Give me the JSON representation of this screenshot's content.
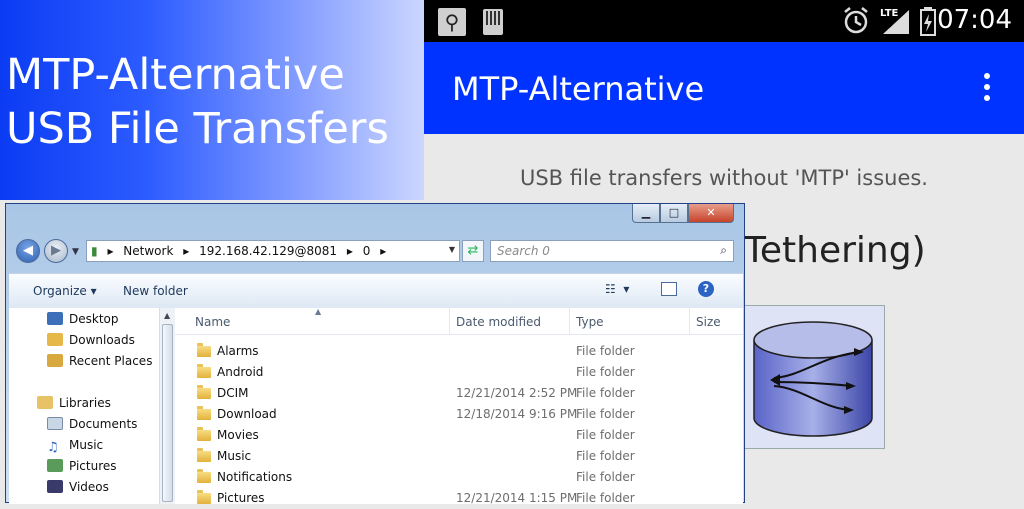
{
  "banner": {
    "line1": "MTP-Alternative",
    "line2": "USB File Transfers"
  },
  "android": {
    "status_bar": {
      "time": "07:04",
      "network": "LTE",
      "icons": [
        "usb-icon",
        "sd-card-icon",
        "alarm-icon",
        "signal-icon",
        "battery-icon"
      ]
    },
    "app_bar": {
      "title": "MTP-Alternative",
      "menu_icon": "overflow-menu-icon",
      "color": "#0033ff"
    },
    "subtitle": "USB file transfers without 'MTP' issues.",
    "partial_heading": "Tethering)"
  },
  "explorer": {
    "address": [
      "Network",
      "192.168.42.129@8081",
      "0"
    ],
    "search_placeholder": "Search 0",
    "toolbar": {
      "organize": "Organize",
      "new_folder": "New folder"
    },
    "nav_items": [
      {
        "label": "Desktop",
        "icon": "desktop-icon"
      },
      {
        "label": "Downloads",
        "icon": "downloads-icon"
      },
      {
        "label": "Recent Places",
        "icon": "recent-places-icon"
      },
      {
        "label": "Libraries",
        "icon": "libraries-icon"
      },
      {
        "label": "Documents",
        "icon": "documents-icon"
      },
      {
        "label": "Music",
        "icon": "music-icon"
      },
      {
        "label": "Pictures",
        "icon": "pictures-icon"
      },
      {
        "label": "Videos",
        "icon": "videos-icon"
      }
    ],
    "columns": {
      "name": "Name",
      "date": "Date modified",
      "type": "Type",
      "size": "Size"
    },
    "files": [
      {
        "name": "Alarms",
        "date": "",
        "type": "File folder"
      },
      {
        "name": "Android",
        "date": "",
        "type": "File folder"
      },
      {
        "name": "DCIM",
        "date": "12/21/2014 2:52 PM",
        "type": "File folder"
      },
      {
        "name": "Download",
        "date": "12/18/2014 9:16 PM",
        "type": "File folder"
      },
      {
        "name": "Movies",
        "date": "",
        "type": "File folder"
      },
      {
        "name": "Music",
        "date": "",
        "type": "File folder"
      },
      {
        "name": "Notifications",
        "date": "",
        "type": "File folder"
      },
      {
        "name": "Pictures",
        "date": "12/21/2014 1:15 PM",
        "type": "File folder"
      }
    ]
  }
}
